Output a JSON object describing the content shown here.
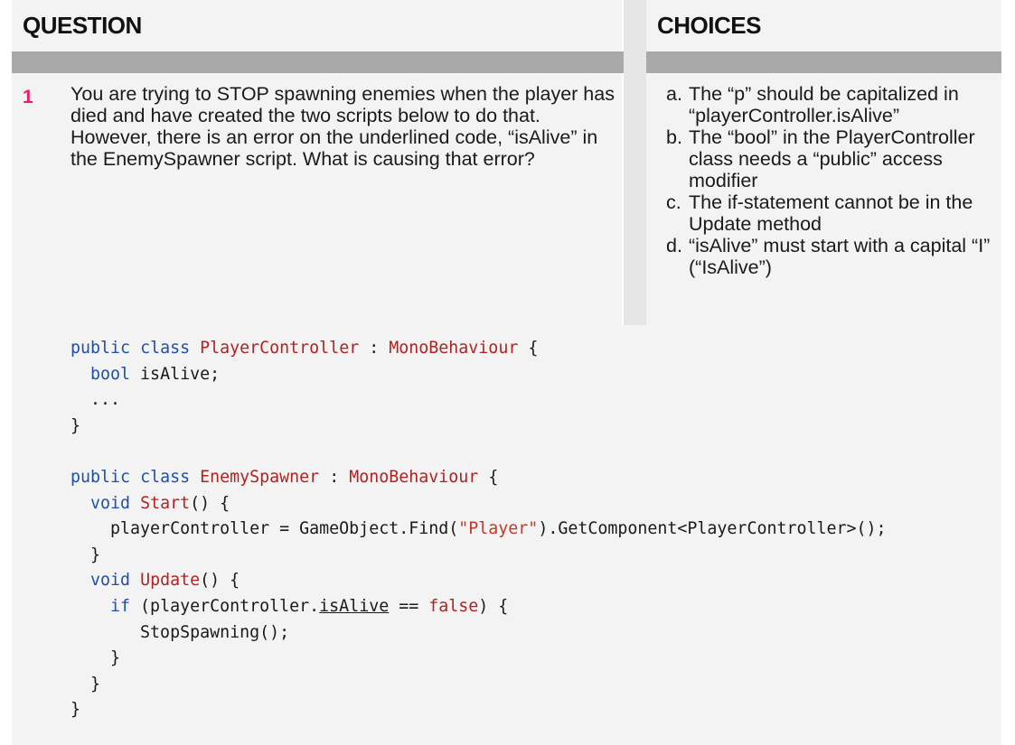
{
  "headers": {
    "question": "QUESTION",
    "choices": "CHOICES"
  },
  "question": {
    "number": "1",
    "text": "You are trying to STOP spawning enemies when the player has died and have created the two scripts below to do that. However, there is an error on the underlined code, “isAlive” in the EnemySpawner script. What is causing that error?"
  },
  "choices": [
    {
      "letter": "a.",
      "text": "The “p” should be capitalized in “playerController.isAlive”"
    },
    {
      "letter": "b.",
      "text": "The “bool” in the PlayerController class needs a “public” access modifier"
    },
    {
      "letter": "c.",
      "text": "The if-statement cannot be in the Update method"
    },
    {
      "letter": "d.",
      "text": "“isAlive” must start with a capital “I” (“IsAlive”)"
    }
  ],
  "code": {
    "l1_public": "public",
    "l1_class": "class",
    "l1_name": "PlayerController",
    "l1_colon": " : ",
    "l1_base": "MonoBehaviour",
    "l1_brace": " {",
    "l2_bool": "bool",
    "l2_rest": " isAlive;",
    "l3": "...",
    "l4": "}",
    "l6_public": "public",
    "l6_class": "class",
    "l6_name": "EnemySpawner",
    "l6_colon": " : ",
    "l6_base": "MonoBehaviour",
    "l6_brace": " {",
    "l7_void": "void",
    "l7_name": "Start",
    "l7_rest": "() {",
    "l8_pre": "playerController = GameObject.Find(",
    "l8_str": "\"Player\"",
    "l8_post": ").GetComponent<PlayerController>();",
    "l9": "}",
    "l10_void": "void",
    "l10_name": "Update",
    "l10_rest": "() {",
    "l11_if": "if",
    "l11_pre": " (playerController.",
    "l11_ul": "isAlive",
    "l11_eq": " == ",
    "l11_false": "false",
    "l11_post": ") {",
    "l12": "StopSpawning();",
    "l13": "}",
    "l14": "}",
    "l15": "}"
  },
  "colors": {
    "keyword": "#1f4fa8",
    "type": "#b22222",
    "question_number": "#e91e63",
    "header_bar": "#a9a9a9"
  }
}
